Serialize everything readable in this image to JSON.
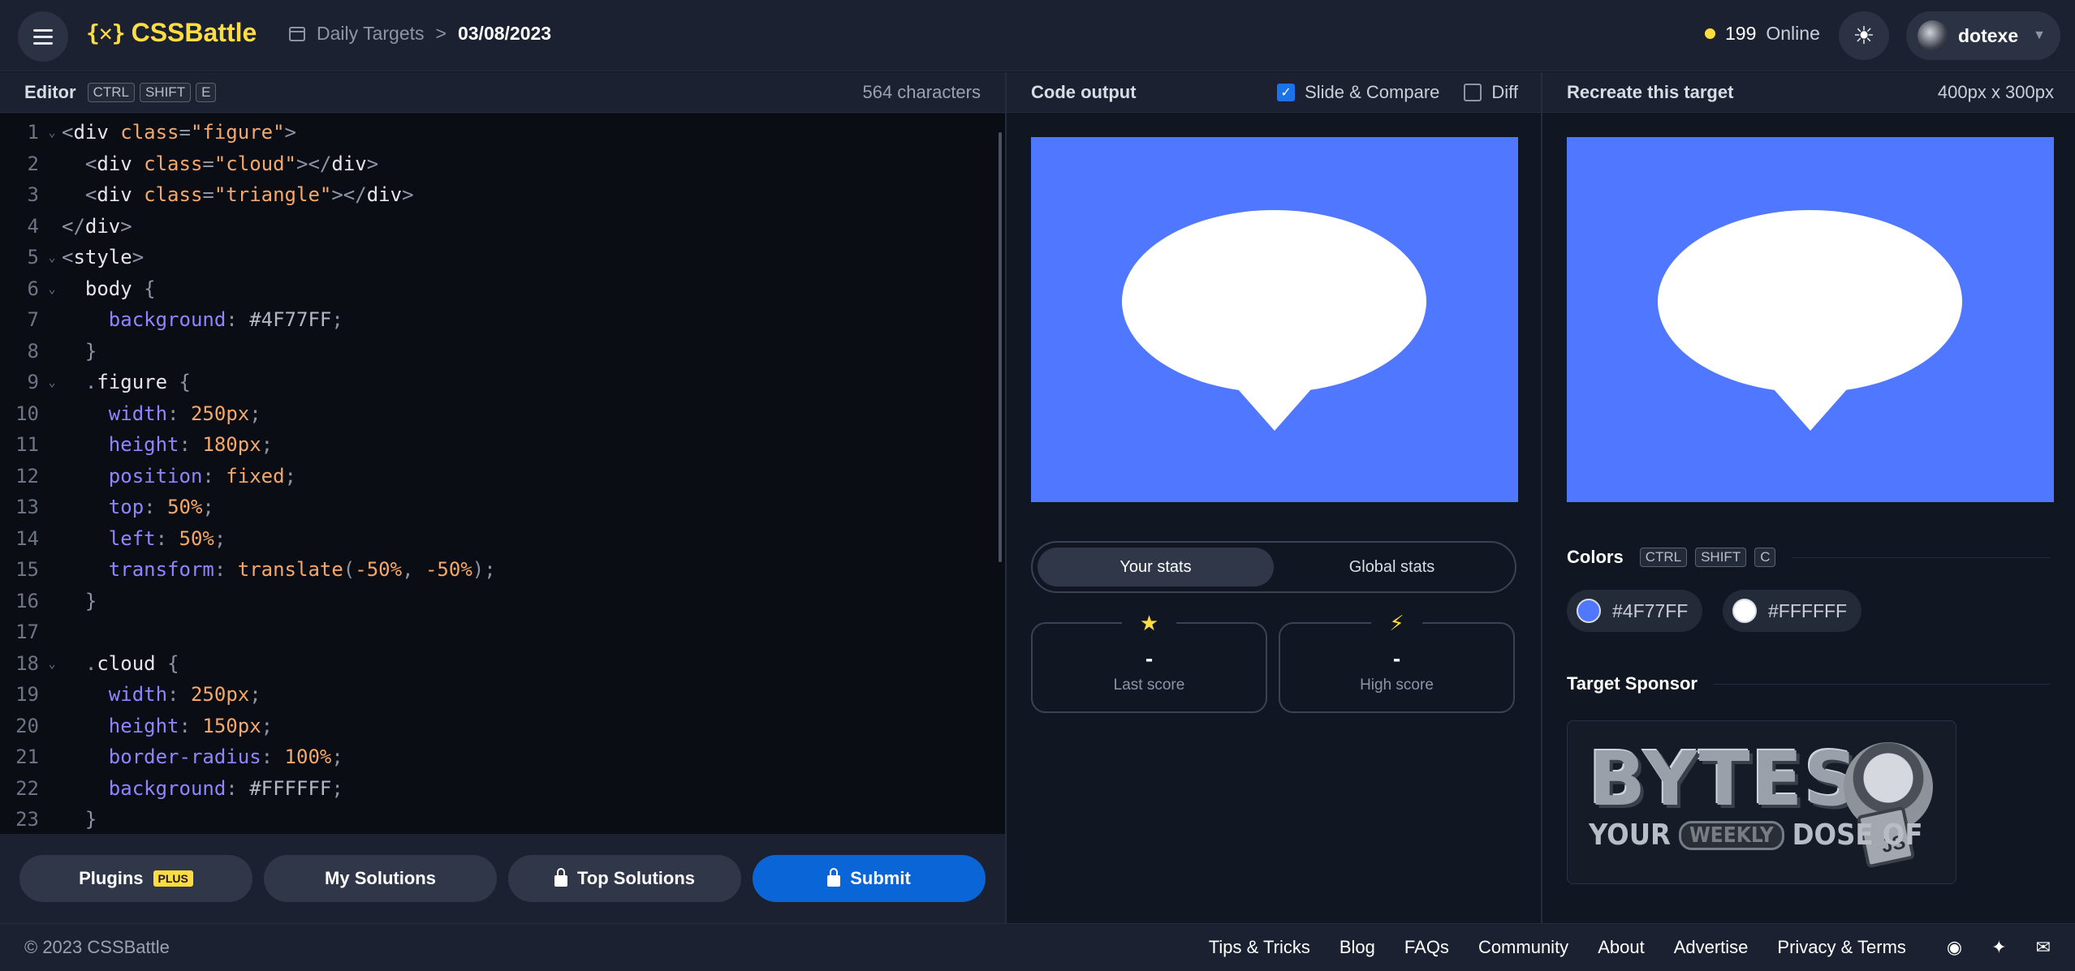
{
  "header": {
    "logo_text": "CSSBattle",
    "logo_mark": "{✕}",
    "breadcrumb_section": "Daily Targets",
    "breadcrumb_separator": ">",
    "breadcrumb_date": "03/08/2023",
    "online_count": "199",
    "online_label": "Online",
    "username": "dotexe"
  },
  "editor": {
    "title": "Editor",
    "shortcut": [
      "CTRL",
      "SHIFT",
      "E"
    ],
    "char_count": "564 characters",
    "lines": [
      {
        "n": "1",
        "fold": true
      },
      {
        "n": "2",
        "fold": false
      },
      {
        "n": "3",
        "fold": false
      },
      {
        "n": "4",
        "fold": false
      },
      {
        "n": "5",
        "fold": true
      },
      {
        "n": "6",
        "fold": true
      },
      {
        "n": "7",
        "fold": false
      },
      {
        "n": "8",
        "fold": false
      },
      {
        "n": "9",
        "fold": true
      },
      {
        "n": "10",
        "fold": false
      },
      {
        "n": "11",
        "fold": false
      },
      {
        "n": "12",
        "fold": false
      },
      {
        "n": "13",
        "fold": false
      },
      {
        "n": "14",
        "fold": false
      },
      {
        "n": "15",
        "fold": false
      },
      {
        "n": "16",
        "fold": false
      },
      {
        "n": "17",
        "fold": false
      },
      {
        "n": "18",
        "fold": true
      },
      {
        "n": "19",
        "fold": false
      },
      {
        "n": "20",
        "fold": false
      },
      {
        "n": "21",
        "fold": false
      },
      {
        "n": "22",
        "fold": false
      },
      {
        "n": "23",
        "fold": false
      }
    ],
    "code_tokens": [
      [
        [
          "t-punct",
          "<"
        ],
        [
          "t-tag",
          "div "
        ],
        [
          "t-attr",
          "class"
        ],
        [
          "t-punct",
          "="
        ],
        [
          "t-str",
          "\"figure\""
        ],
        [
          "t-punct",
          ">"
        ]
      ],
      [
        [
          "t-punct",
          "  <"
        ],
        [
          "t-tag",
          "div "
        ],
        [
          "t-attr",
          "class"
        ],
        [
          "t-punct",
          "="
        ],
        [
          "t-str",
          "\"cloud\""
        ],
        [
          "t-punct",
          "></"
        ],
        [
          "t-tag",
          "div"
        ],
        [
          "t-punct",
          ">"
        ]
      ],
      [
        [
          "t-punct",
          "  <"
        ],
        [
          "t-tag",
          "div "
        ],
        [
          "t-attr",
          "class"
        ],
        [
          "t-punct",
          "="
        ],
        [
          "t-str",
          "\"triangle\""
        ],
        [
          "t-punct",
          "></"
        ],
        [
          "t-tag",
          "div"
        ],
        [
          "t-punct",
          ">"
        ]
      ],
      [
        [
          "t-punct",
          "</"
        ],
        [
          "t-tag",
          "div"
        ],
        [
          "t-punct",
          ">"
        ]
      ],
      [
        [
          "t-punct",
          "<"
        ],
        [
          "t-tag",
          "style"
        ],
        [
          "t-punct",
          ">"
        ]
      ],
      [
        [
          "t-sel",
          "  body "
        ],
        [
          "t-punct",
          "{"
        ]
      ],
      [
        [
          "t-prop",
          "    background"
        ],
        [
          "t-punct",
          ": "
        ],
        [
          "t-hex",
          "#4F77FF"
        ],
        [
          "t-punct",
          ";"
        ]
      ],
      [
        [
          "t-punct",
          "  }"
        ]
      ],
      [
        [
          "t-punct",
          "  ."
        ],
        [
          "t-sel",
          "figure "
        ],
        [
          "t-punct",
          "{"
        ]
      ],
      [
        [
          "t-prop",
          "    width"
        ],
        [
          "t-punct",
          ": "
        ],
        [
          "t-num",
          "250"
        ],
        [
          "t-val",
          "px"
        ],
        [
          "t-punct",
          ";"
        ]
      ],
      [
        [
          "t-prop",
          "    height"
        ],
        [
          "t-punct",
          ": "
        ],
        [
          "t-num",
          "180"
        ],
        [
          "t-val",
          "px"
        ],
        [
          "t-punct",
          ";"
        ]
      ],
      [
        [
          "t-prop",
          "    position"
        ],
        [
          "t-punct",
          ": "
        ],
        [
          "t-val",
          "fixed"
        ],
        [
          "t-punct",
          ";"
        ]
      ],
      [
        [
          "t-prop",
          "    top"
        ],
        [
          "t-punct",
          ": "
        ],
        [
          "t-num",
          "50"
        ],
        [
          "t-val",
          "%"
        ],
        [
          "t-punct",
          ";"
        ]
      ],
      [
        [
          "t-prop",
          "    left"
        ],
        [
          "t-punct",
          ": "
        ],
        [
          "t-num",
          "50"
        ],
        [
          "t-val",
          "%"
        ],
        [
          "t-punct",
          ";"
        ]
      ],
      [
        [
          "t-prop",
          "    transform"
        ],
        [
          "t-punct",
          ": "
        ],
        [
          "t-fn",
          "translate"
        ],
        [
          "t-punct",
          "("
        ],
        [
          "t-num",
          "-50"
        ],
        [
          "t-val",
          "%"
        ],
        [
          "t-punct",
          ", "
        ],
        [
          "t-num",
          "-50"
        ],
        [
          "t-val",
          "%"
        ],
        [
          "t-punct",
          ");"
        ]
      ],
      [
        [
          "t-punct",
          "  }"
        ]
      ],
      [
        [
          "t-punct",
          ""
        ]
      ],
      [
        [
          "t-punct",
          "  ."
        ],
        [
          "t-sel",
          "cloud "
        ],
        [
          "t-punct",
          "{"
        ]
      ],
      [
        [
          "t-prop",
          "    width"
        ],
        [
          "t-punct",
          ": "
        ],
        [
          "t-num",
          "250"
        ],
        [
          "t-val",
          "px"
        ],
        [
          "t-punct",
          ";"
        ]
      ],
      [
        [
          "t-prop",
          "    height"
        ],
        [
          "t-punct",
          ": "
        ],
        [
          "t-num",
          "150"
        ],
        [
          "t-val",
          "px"
        ],
        [
          "t-punct",
          ";"
        ]
      ],
      [
        [
          "t-prop",
          "    border-radius"
        ],
        [
          "t-punct",
          ": "
        ],
        [
          "t-num",
          "100"
        ],
        [
          "t-val",
          "%"
        ],
        [
          "t-punct",
          ";"
        ]
      ],
      [
        [
          "t-prop",
          "    background"
        ],
        [
          "t-punct",
          ": "
        ],
        [
          "t-hex",
          "#FFFFFF"
        ],
        [
          "t-punct",
          ";"
        ]
      ],
      [
        [
          "t-punct",
          "  }"
        ]
      ]
    ]
  },
  "editor_footer": {
    "plugins_label": "Plugins",
    "plus_badge": "PLUS",
    "my_solutions_label": "My Solutions",
    "top_solutions_label": "Top Solutions",
    "submit_label": "Submit"
  },
  "output": {
    "title": "Code output",
    "slide_compare_label": "Slide & Compare",
    "slide_compare_checked": true,
    "diff_label": "Diff",
    "diff_checked": false,
    "tabs": [
      "Your stats",
      "Global stats"
    ],
    "last_score_value": "-",
    "last_score_label": "Last score",
    "high_score_value": "-",
    "high_score_label": "High score"
  },
  "target": {
    "title": "Recreate this target",
    "size": "400px x 300px",
    "colors_title": "Colors",
    "colors_shortcut": [
      "CTRL",
      "SHIFT",
      "C"
    ],
    "colors": [
      {
        "hex": "#4F77FF",
        "label": "#4F77FF"
      },
      {
        "hex": "#FFFFFF",
        "label": "#FFFFFF"
      }
    ],
    "sponsor_title": "Target Sponsor",
    "sponsor_logo_word": "BYTES",
    "sponsor_tagline_1": "YOUR",
    "sponsor_tagline_2": "WEEKLY",
    "sponsor_tagline_3": "DOSE OF",
    "sponsor_js": "JS"
  },
  "canvas": {
    "background": "#4F77FF",
    "shape_color": "#FFFFFF"
  },
  "footer": {
    "copyright": "© 2023 CSSBattle",
    "links": [
      "Tips & Tricks",
      "Blog",
      "FAQs",
      "Community",
      "About",
      "Advertise",
      "Privacy & Terms"
    ],
    "social_icons": [
      "discord-icon",
      "twitter-icon",
      "mail-icon"
    ]
  }
}
